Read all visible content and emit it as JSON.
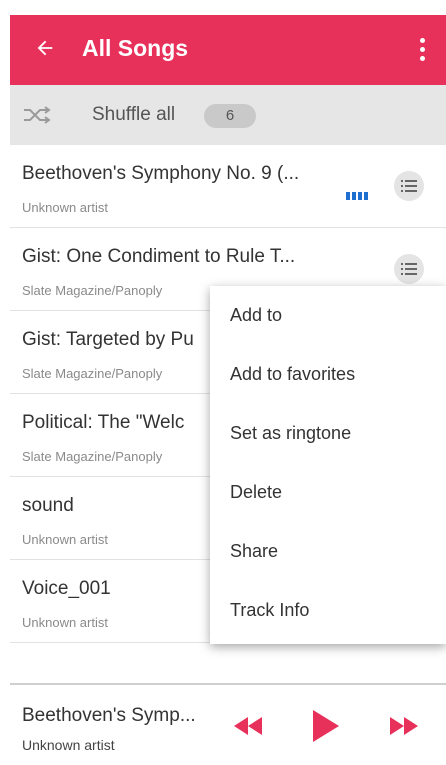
{
  "app": {
    "title": "All Songs",
    "accent_color": "#e8315a",
    "icons": {
      "back": "arrow-left-icon",
      "overflow": "more-vert-icon"
    }
  },
  "shuffle": {
    "label": "Shuffle all",
    "count": "6",
    "icon": "shuffle-icon"
  },
  "songs": [
    {
      "title": "Beethoven's Symphony No. 9 (...",
      "artist": "Unknown artist",
      "playing": true
    },
    {
      "title": "Gist: One Condiment to Rule T...",
      "artist": "Slate Magazine/Panoply",
      "playing": false
    },
    {
      "title": "Gist: Targeted by Pu",
      "artist": "Slate Magazine/Panoply",
      "playing": false
    },
    {
      "title": "Political: The \"Welc",
      "artist": "Slate Magazine/Panoply",
      "playing": false
    },
    {
      "title": "sound",
      "artist": "Unknown artist",
      "playing": false
    },
    {
      "title": "Voice_001",
      "artist": "Unknown artist",
      "playing": false
    }
  ],
  "context_menu": {
    "items": [
      "Add to",
      "Add to favorites",
      "Set as ringtone",
      "Delete",
      "Share",
      "Track Info"
    ]
  },
  "now_playing": {
    "title": "Beethoven's Symp...",
    "artist": "Unknown artist",
    "controls": {
      "previous": "rewind-icon",
      "play": "play-icon",
      "next": "fast-forward-icon"
    }
  }
}
